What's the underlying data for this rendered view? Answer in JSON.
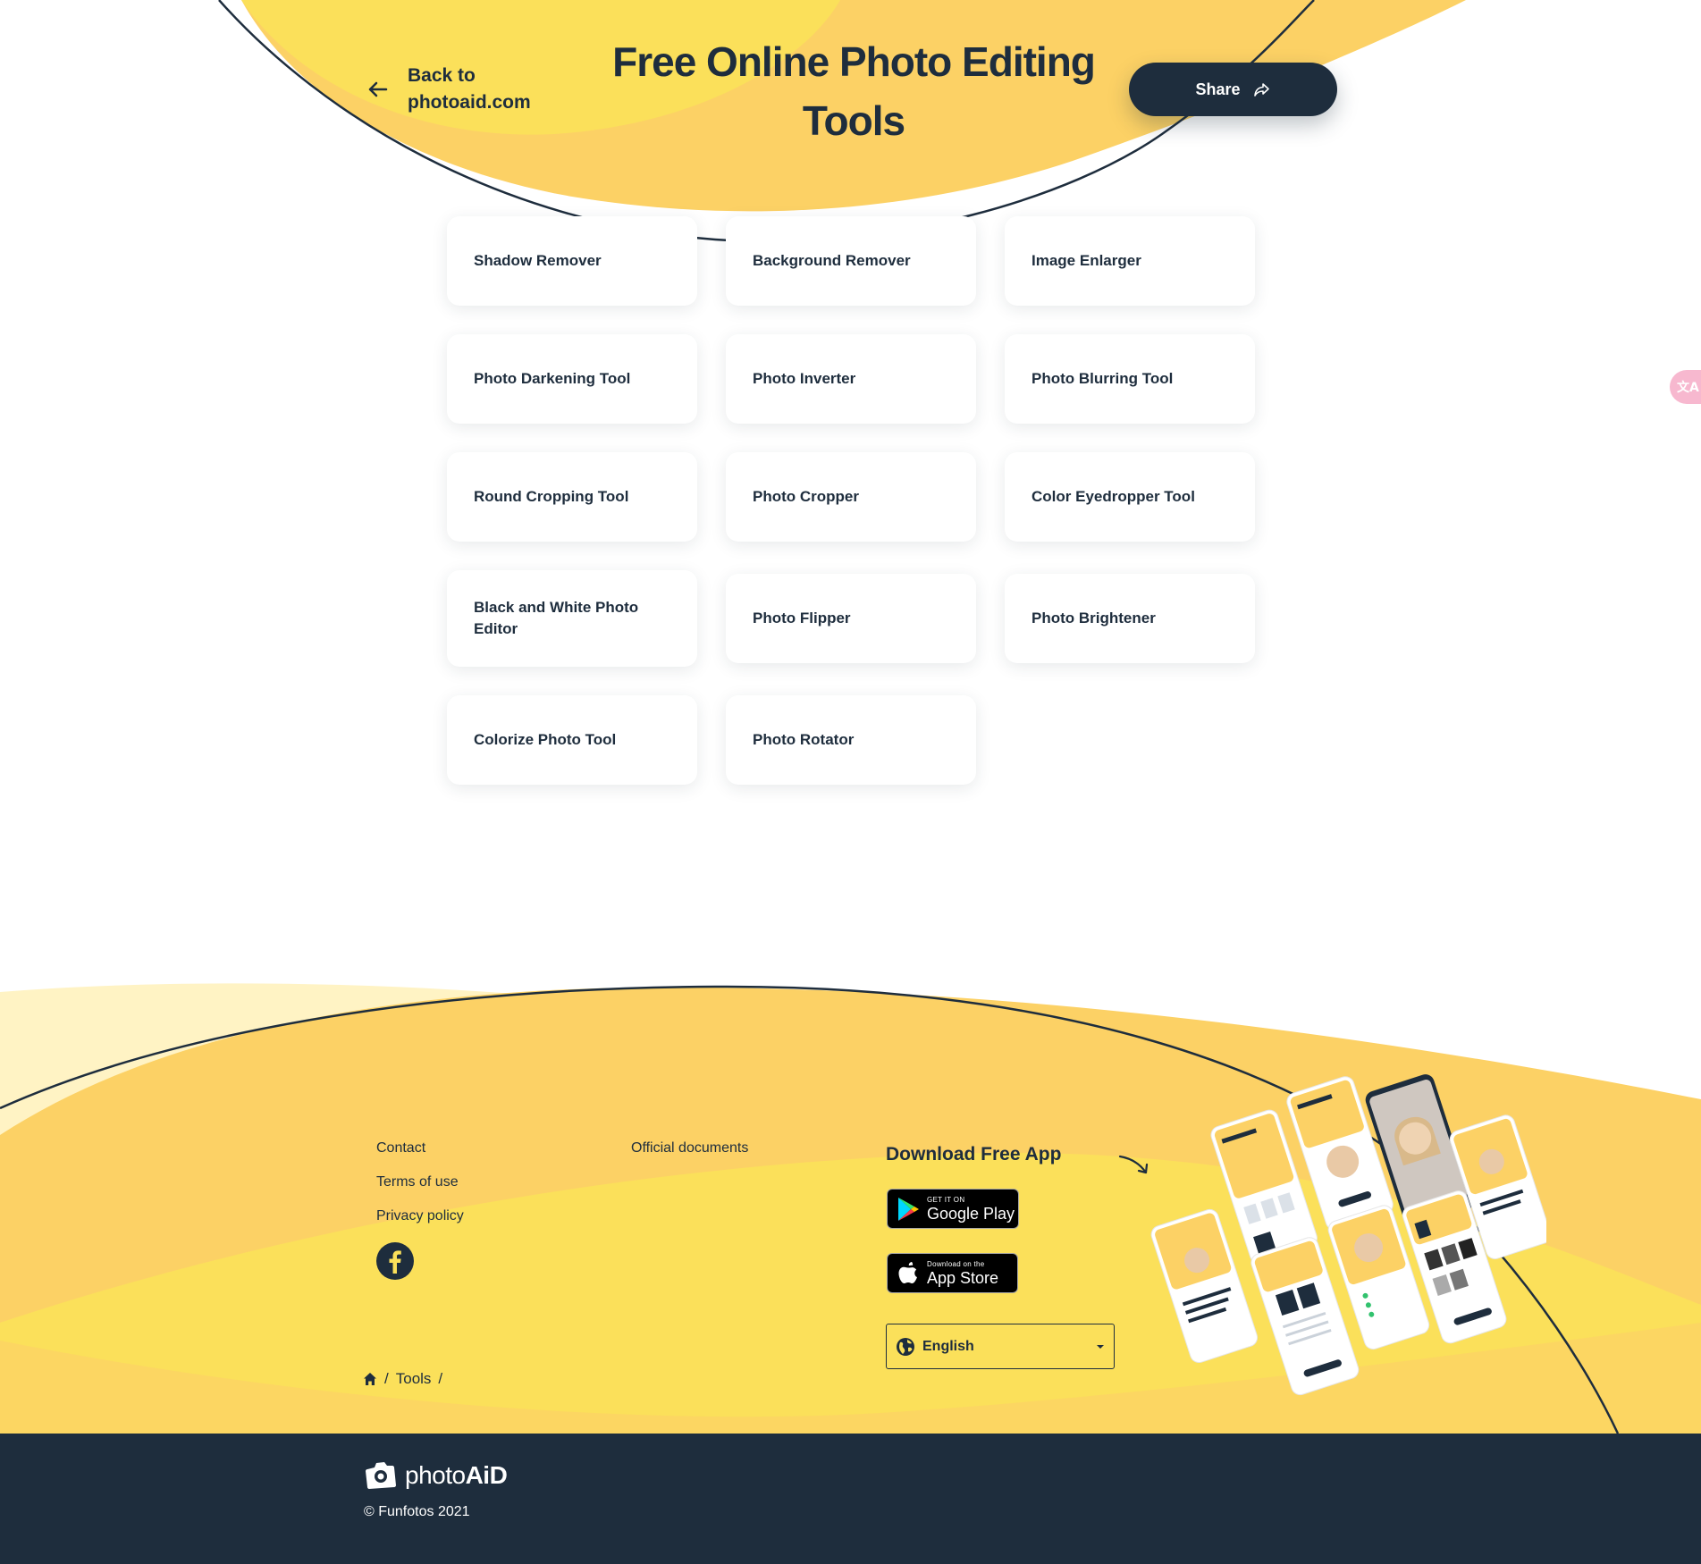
{
  "header": {
    "back_label": "Back to photoaid.com",
    "title": "Free Online Photo Editing Tools",
    "share_label": "Share"
  },
  "tools": [
    {
      "label": "Shadow Remover"
    },
    {
      "label": "Background Remover"
    },
    {
      "label": "Image Enlarger"
    },
    {
      "label": "Photo Darkening Tool"
    },
    {
      "label": "Photo Inverter"
    },
    {
      "label": "Photo Blurring Tool"
    },
    {
      "label": "Round Cropping Tool"
    },
    {
      "label": "Photo Cropper"
    },
    {
      "label": "Color Eyedropper Tool"
    },
    {
      "label": "Black and White Photo Editor"
    },
    {
      "label": "Photo Flipper"
    },
    {
      "label": "Photo Brightener"
    },
    {
      "label": "Colorize Photo Tool"
    },
    {
      "label": "Photo Rotator"
    }
  ],
  "footer": {
    "links": [
      "Contact",
      "Terms of use",
      "Privacy policy"
    ],
    "official_docs": "Official documents",
    "download_title": "Download Free App",
    "google_play": {
      "small": "GET IT ON",
      "big": "Google Play"
    },
    "app_store": {
      "small": "Download on the",
      "big": "App Store"
    },
    "language": "English",
    "breadcrumb": {
      "tools": "Tools",
      "sep": "/"
    },
    "icons": {
      "social": "facebook-icon",
      "home": "home-icon",
      "globe": "globe-icon"
    }
  },
  "bottom": {
    "logo_light": "photo",
    "logo_bold": "AiD",
    "copyright": "© Funfotos 2021"
  },
  "translate_tab": {
    "glyph": "文A"
  },
  "colors": {
    "navy": "#1e2d3d",
    "yellow": "#fbe05a",
    "yellow_dark": "#fcd165",
    "yellow_light": "#fff3c4",
    "white": "#ffffff"
  }
}
